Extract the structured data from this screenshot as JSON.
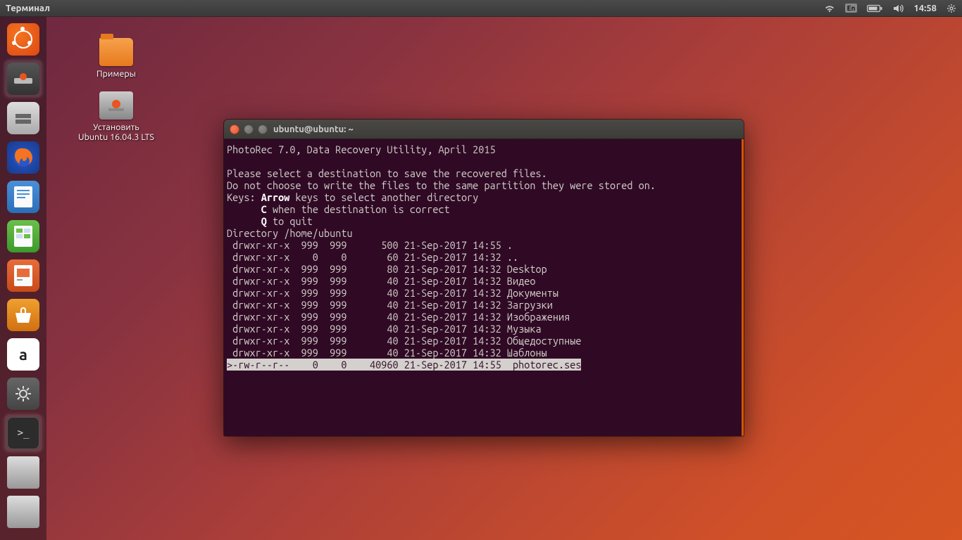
{
  "panel": {
    "app_title": "Терминал",
    "lang": "En",
    "clock": "14:58"
  },
  "desktop": {
    "icon1_label": "Примеры",
    "icon2_label": "Установить\nUbuntu 16.04.3 LTS"
  },
  "terminal": {
    "title": "ubuntu@ubuntu: ~",
    "header": "PhotoRec 7.0, Data Recovery Utility, April 2015",
    "msg1": "Please select a destination to save the recovered files.",
    "msg2": "Do not choose to write the files to the same partition they were stored on.",
    "keys_label": "Keys: ",
    "key_arrow": "Arrow",
    "key_arrow_desc": " keys to select another directory",
    "key_c": "C",
    "key_c_desc": " when the destination is correct",
    "key_q": "Q",
    "key_q_desc": " to quit",
    "dir_label": "Directory ",
    "dir_path": "/home/ubuntu",
    "listing": [
      {
        "perm": " drwxr-xr-x",
        "uid": "  999",
        "gid": "  999",
        "size": "      500",
        "date": "21-Sep-2017 14:55",
        "name": "."
      },
      {
        "perm": " drwxr-xr-x",
        "uid": "    0",
        "gid": "    0",
        "size": "       60",
        "date": "21-Sep-2017 14:32",
        "name": ".."
      },
      {
        "perm": " drwxr-xr-x",
        "uid": "  999",
        "gid": "  999",
        "size": "       80",
        "date": "21-Sep-2017 14:32",
        "name": "Desktop"
      },
      {
        "perm": " drwxr-xr-x",
        "uid": "  999",
        "gid": "  999",
        "size": "       40",
        "date": "21-Sep-2017 14:32",
        "name": "Видео"
      },
      {
        "perm": " drwxr-xr-x",
        "uid": "  999",
        "gid": "  999",
        "size": "       40",
        "date": "21-Sep-2017 14:32",
        "name": "Документы"
      },
      {
        "perm": " drwxr-xr-x",
        "uid": "  999",
        "gid": "  999",
        "size": "       40",
        "date": "21-Sep-2017 14:32",
        "name": "Загрузки"
      },
      {
        "perm": " drwxr-xr-x",
        "uid": "  999",
        "gid": "  999",
        "size": "       40",
        "date": "21-Sep-2017 14:32",
        "name": "Изображения"
      },
      {
        "perm": " drwxr-xr-x",
        "uid": "  999",
        "gid": "  999",
        "size": "       40",
        "date": "21-Sep-2017 14:32",
        "name": "Музыка"
      },
      {
        "perm": " drwxr-xr-x",
        "uid": "  999",
        "gid": "  999",
        "size": "       40",
        "date": "21-Sep-2017 14:32",
        "name": "Общедоступные"
      },
      {
        "perm": " drwxr-xr-x",
        "uid": "  999",
        "gid": "  999",
        "size": "       40",
        "date": "21-Sep-2017 14:32",
        "name": "Шаблоны"
      }
    ],
    "selected": {
      "perm": ">-rw-r--r--",
      "uid": "    0",
      "gid": "    0",
      "size": "    40960",
      "date": "21-Sep-2017 14:55",
      "name": " photorec.ses"
    }
  }
}
